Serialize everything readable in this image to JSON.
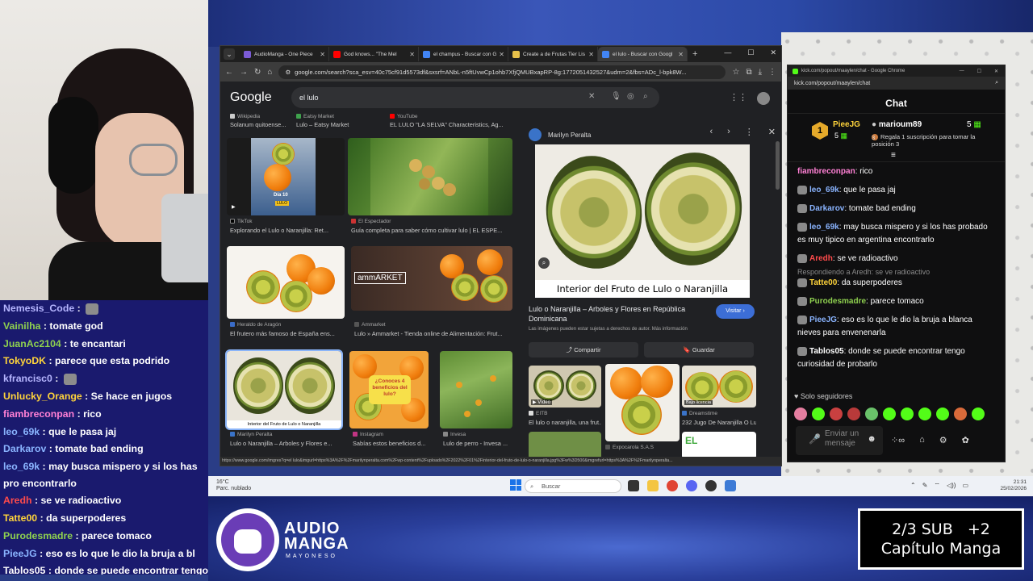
{
  "stream_chat": [
    {
      "user": "Nemesis_Code",
      "msg": "",
      "color": "#b6b6ff"
    },
    {
      "user": "Vainilha",
      "msg": "tomate god",
      "color": "#8fd14f"
    },
    {
      "user": "JuanAc2104",
      "msg": "te encantari",
      "color": "#8fd14f"
    },
    {
      "user": "TokyoDK",
      "msg": "parece que esta podrido",
      "color": "#ffd43b"
    },
    {
      "user": "kfrancisc0",
      "msg": "",
      "color": "#b6b6ff"
    },
    {
      "user": "Unlucky_Orange",
      "msg": "Se hace en jugos",
      "color": "#ffd43b"
    },
    {
      "user": "fiambreconpan",
      "msg": "rico",
      "color": "#ff80d5"
    },
    {
      "user": "leo_69k",
      "msg": "que le pasa jaj",
      "color": "#8ab4ff"
    },
    {
      "user": "Darkarov",
      "msg": "tomate bad ending",
      "color": "#8ab4ff"
    },
    {
      "user": "leo_69k",
      "msg": "may busca mispero y si los has pro encontrarlo",
      "color": "#8ab4ff"
    },
    {
      "user": "Aredh",
      "msg": "se ve radioactivo",
      "color": "#ff4b4b"
    },
    {
      "user": "Tatte00",
      "msg": "da superpoderes",
      "color": "#ffd43b"
    },
    {
      "user": "Purodesmadre",
      "msg": "parece tomaco",
      "color": "#8fd14f"
    },
    {
      "user": "PieeJG",
      "msg": "eso es lo que le dio la bruja a bl",
      "color": "#8ab4ff"
    },
    {
      "user": "Tablos05",
      "msg": "donde se puede encontrar tengo cur",
      "color": "#ffffff"
    }
  ],
  "browser": {
    "tabs": [
      {
        "label": "AudioManga - One Piece",
        "color": "#7b5bd6"
      },
      {
        "label": "God knows... \"The Mel",
        "color": "#ff0000"
      },
      {
        "label": "el champus - Buscar con G",
        "color": "#4285f4"
      },
      {
        "label": "Create a de Frutas Tier Lis",
        "color": "#e7c14a"
      },
      {
        "label": "el lulo - Buscar con Googl",
        "color": "#4285f4"
      }
    ],
    "url": "google.com/search?sca_esv=40c75cf91d5573df&sxsrf=ANbL-n5ftUvwCp1ohb7XfjQMUBxapRP-8g:1772051432527&udm=2&fbs=ADc_l-bpk8W...",
    "google_logo": "Google",
    "query": "el lulo",
    "status_url": "https://www.google.com/imgres?q=el lulo&imgurl=https%3A%2F%2Fmarilynperalta.com%2Fwp-content%2Fuploads%2F2022%2F01%2Finterior-del-fruto-de-lulo-o-naranjilla.jpg%3Fw%3D500&imgrefurl=https%3A%2F%2Fmarilynperalta..."
  },
  "results": {
    "top_sources": [
      {
        "src": "Wikipedia",
        "cap": "Solanum quitoense..."
      },
      {
        "src": "Eatsy Market",
        "cap": "Lulo – Eatsy Market"
      },
      {
        "src": "YouTube",
        "cap": "EL LULO \"LA SELVA\" Characteristics, Ag..."
      }
    ],
    "row1": [
      {
        "src": "TikTok",
        "cap": "Explorando el Lulo o Naranjilla: Ret...",
        "overlay": "Día 10",
        "overlay2": "LULO"
      },
      {
        "src": "El Espectador",
        "cap": "Guía completa para saber cómo cultivar lulo | EL ESPE..."
      }
    ],
    "row2": [
      {
        "src": "Heraldo de Aragón",
        "cap": "El frutero más famoso de España ens..."
      },
      {
        "src": "Ammarket",
        "cap": "Lulo » Ammarket - Tienda online de Alimentación: Frut...",
        "brand": "ammARKET"
      }
    ],
    "row3": [
      {
        "src": "Marilyn Peralta",
        "cap": "Lulo o Naranjilla – Arboles y Flores e...",
        "overlay": "Interior del Fruto de Lulo o Naranjilla"
      },
      {
        "src": "Instagram",
        "cap": "Sabías estos beneficios d...",
        "overlay": "¿Conoces 4 beneficios del lulo?"
      },
      {
        "src": "Invesa",
        "cap": "Lulo de perro - Invesa ..."
      }
    ]
  },
  "panel": {
    "site": "Marilyn Peralta",
    "image_caption": "Interior del Fruto de Lulo o Naranjilla",
    "heading": "Lulo o Naranjilla – Arboles y Flores en República Dominicana",
    "visit": "Visitar",
    "note": "Las imágenes pueden estar sujetas a derechos de autor. Más información",
    "share": "Compartir",
    "save": "Guardar",
    "thumbs": [
      {
        "src": "EITB",
        "cap": "El lulo o naranjilla, una frut...",
        "badge": "Vídeo"
      },
      {
        "src": "Dreamstime",
        "cap": "232 Jugo De Naranjilla O Lu...",
        "badge": "Bajo licencia"
      },
      {
        "src": "Expocarola S.A.S",
        "cap": ""
      }
    ]
  },
  "kick": {
    "window_title": "kick.com/popout/maaylen/chat - Google Chrome",
    "addr": "kick.com/popout/maaylen/chat",
    "header": "Chat",
    "leader1": {
      "name": "PieeJG",
      "rank": "1",
      "count": "5"
    },
    "leader2": {
      "name": "marioum89",
      "count": "5",
      "rank": "3",
      "note": "Regala 1 suscripción para tomar la posición 3"
    },
    "messages": [
      {
        "user": "fiambreconpan",
        "msg": "rico",
        "color": "#ff80d5"
      },
      {
        "user": "leo_69k",
        "msg": "que le pasa jaj",
        "color": "#8ab4ff"
      },
      {
        "user": "Darkarov",
        "msg": "tomate bad ending",
        "color": "#8ab4ff"
      },
      {
        "user": "leo_69k",
        "msg": "may busca mispero y si los has probado es muy tipico en argentina encontrarlo",
        "color": "#8ab4ff"
      },
      {
        "user": "Aredh",
        "msg": "se ve radioactivo",
        "color": "#ff4b4b"
      },
      {
        "user": "Tatte00",
        "msg": "da superpoderes",
        "color": "#ffd43b",
        "reply": "Respondiendo a Aredh: se ve radioactivo"
      },
      {
        "user": "Purodesmadre",
        "msg": "parece tomaco",
        "color": "#8fd14f"
      },
      {
        "user": "PieeJG",
        "msg": "eso es lo que le dio la bruja a blanca nieves para envenenarla",
        "color": "#8ab4ff"
      },
      {
        "user": "Tablos05",
        "msg": "donde se puede encontrar tengo curiosidad de probarlo",
        "color": "#ffffff"
      }
    ],
    "followers_only": "Solo seguidores",
    "input_placeholder": "Enviar un mensaje"
  },
  "taskbar": {
    "weather_temp": "16°C",
    "weather_desc": "Parc. nublado",
    "search": "Buscar",
    "time": "21:31",
    "date": "25/02/2026"
  },
  "overlay": {
    "logo_line1": "AUDIO",
    "logo_line2": "MANGA",
    "logo_sub": "MAYONESO",
    "sub_line1": "2/3 SUB   +2",
    "sub_line2": "Capítulo Manga"
  }
}
